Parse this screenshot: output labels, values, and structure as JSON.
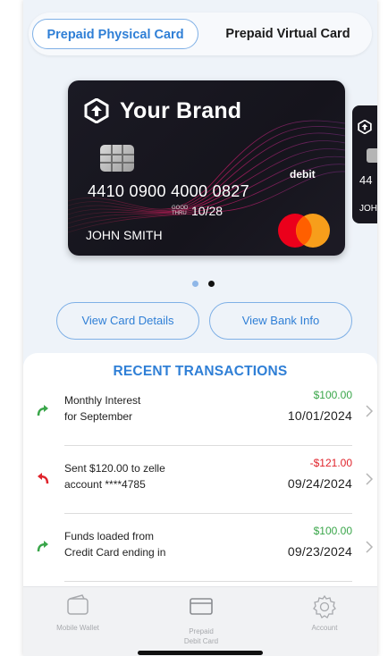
{
  "tabs": {
    "physical": "Prepaid Physical Card",
    "virtual": "Prepaid Virtual Card"
  },
  "card": {
    "brand": "Your Brand",
    "type_label": "debit",
    "number": "4410 0900 4000 0827",
    "good_thru": "GOOD THRU",
    "expiry": "10/28",
    "holder": "JOHN SMITH",
    "network_icon": "mastercard-logo",
    "colors": {
      "card_bg": "#1b1a24",
      "accent_wave": "#c2185b",
      "mc_red": "#eb001b",
      "mc_orange": "#f79e1b"
    }
  },
  "card_peek": {
    "number": "44",
    "holder": "JOH"
  },
  "pager": {
    "total": 2,
    "active_index": 1
  },
  "buttons": {
    "view_details": "View Card Details",
    "view_bank": "View Bank Info"
  },
  "transactions": {
    "title": "RECENT TRANSACTIONS",
    "items": [
      {
        "line1": "Monthly Interest",
        "line2": "for September",
        "amount": "$100.00",
        "date": "10/01/2024",
        "direction": "incoming"
      },
      {
        "line1": "Sent $120.00 to zelle",
        "line2": "account ****4785",
        "amount": "-$121.00",
        "date": "09/24/2024",
        "direction": "outgoing"
      },
      {
        "line1": "Funds loaded from",
        "line2": "Credit Card ending in",
        "amount": "$100.00",
        "date": "09/23/2024",
        "direction": "incoming"
      }
    ]
  },
  "bottom_nav": {
    "wallet": "Mobile Wallet",
    "prepaid_line1": "Prepaid",
    "prepaid_line2": "Debit Card",
    "account": "Account"
  },
  "colors": {
    "accent": "#2f7fd6",
    "positive": "#3aa64a",
    "negative": "#e0242c",
    "background": "#eef3f9"
  }
}
